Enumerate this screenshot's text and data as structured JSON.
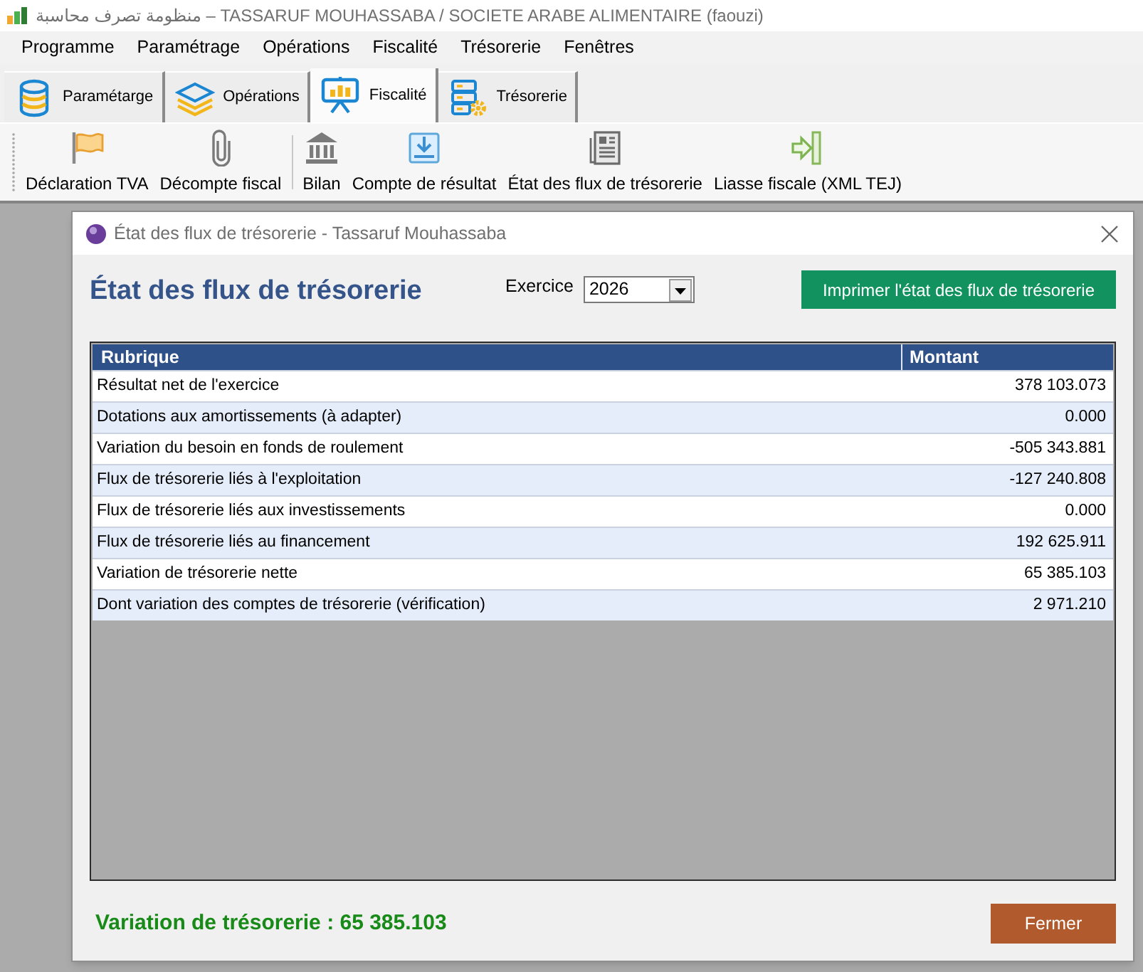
{
  "window": {
    "title": "منظومة تصرف محاسبة – TASSARUF MOUHASSABA / SOCIETE ARABE ALIMENTAIRE (faouzi)"
  },
  "menu": [
    "Programme",
    "Paramétrage",
    "Opérations",
    "Fiscalité",
    "Trésorerie",
    "Fenêtres"
  ],
  "tabs": [
    {
      "label": "Paramétarge",
      "selected": false
    },
    {
      "label": "Opérations",
      "selected": false
    },
    {
      "label": "Fiscalité",
      "selected": true
    },
    {
      "label": "Trésorerie",
      "selected": false
    }
  ],
  "toolbar": {
    "groups": [
      [
        "Déclaration TVA",
        "Décompte fiscal"
      ],
      [
        "Bilan",
        "Compte de résultat",
        "État des flux de trésorerie",
        "Liasse fiscale (XML TEJ)"
      ]
    ]
  },
  "dialog": {
    "title": "État des flux de trésorerie - Tassaruf Mouhassaba",
    "heading": "État des flux de trésorerie",
    "exercice": {
      "label": "Exercice",
      "value": "2026"
    },
    "print_button": "Imprimer l'état des flux de trésorerie",
    "table": {
      "columns": [
        "Rubrique",
        "Montant"
      ],
      "rows": [
        [
          "Résultat net de l'exercice",
          "378 103.073"
        ],
        [
          "Dotations aux amortissements (à adapter)",
          "0.000"
        ],
        [
          "Variation du besoin en fonds de roulement",
          "-505 343.881"
        ],
        [
          "Flux de trésorerie liés à l'exploitation",
          "-127 240.808"
        ],
        [
          "Flux de trésorerie liés aux investissements",
          "0.000"
        ],
        [
          "Flux de trésorerie liés au financement",
          "192 625.911"
        ],
        [
          "Variation de trésorerie nette",
          "65 385.103"
        ],
        [
          "Dont variation des comptes de trésorerie (vérification)",
          "2 971.210"
        ]
      ]
    },
    "summary": "Variation de trésorerie : 65 385.103",
    "close_button": "Fermer"
  }
}
